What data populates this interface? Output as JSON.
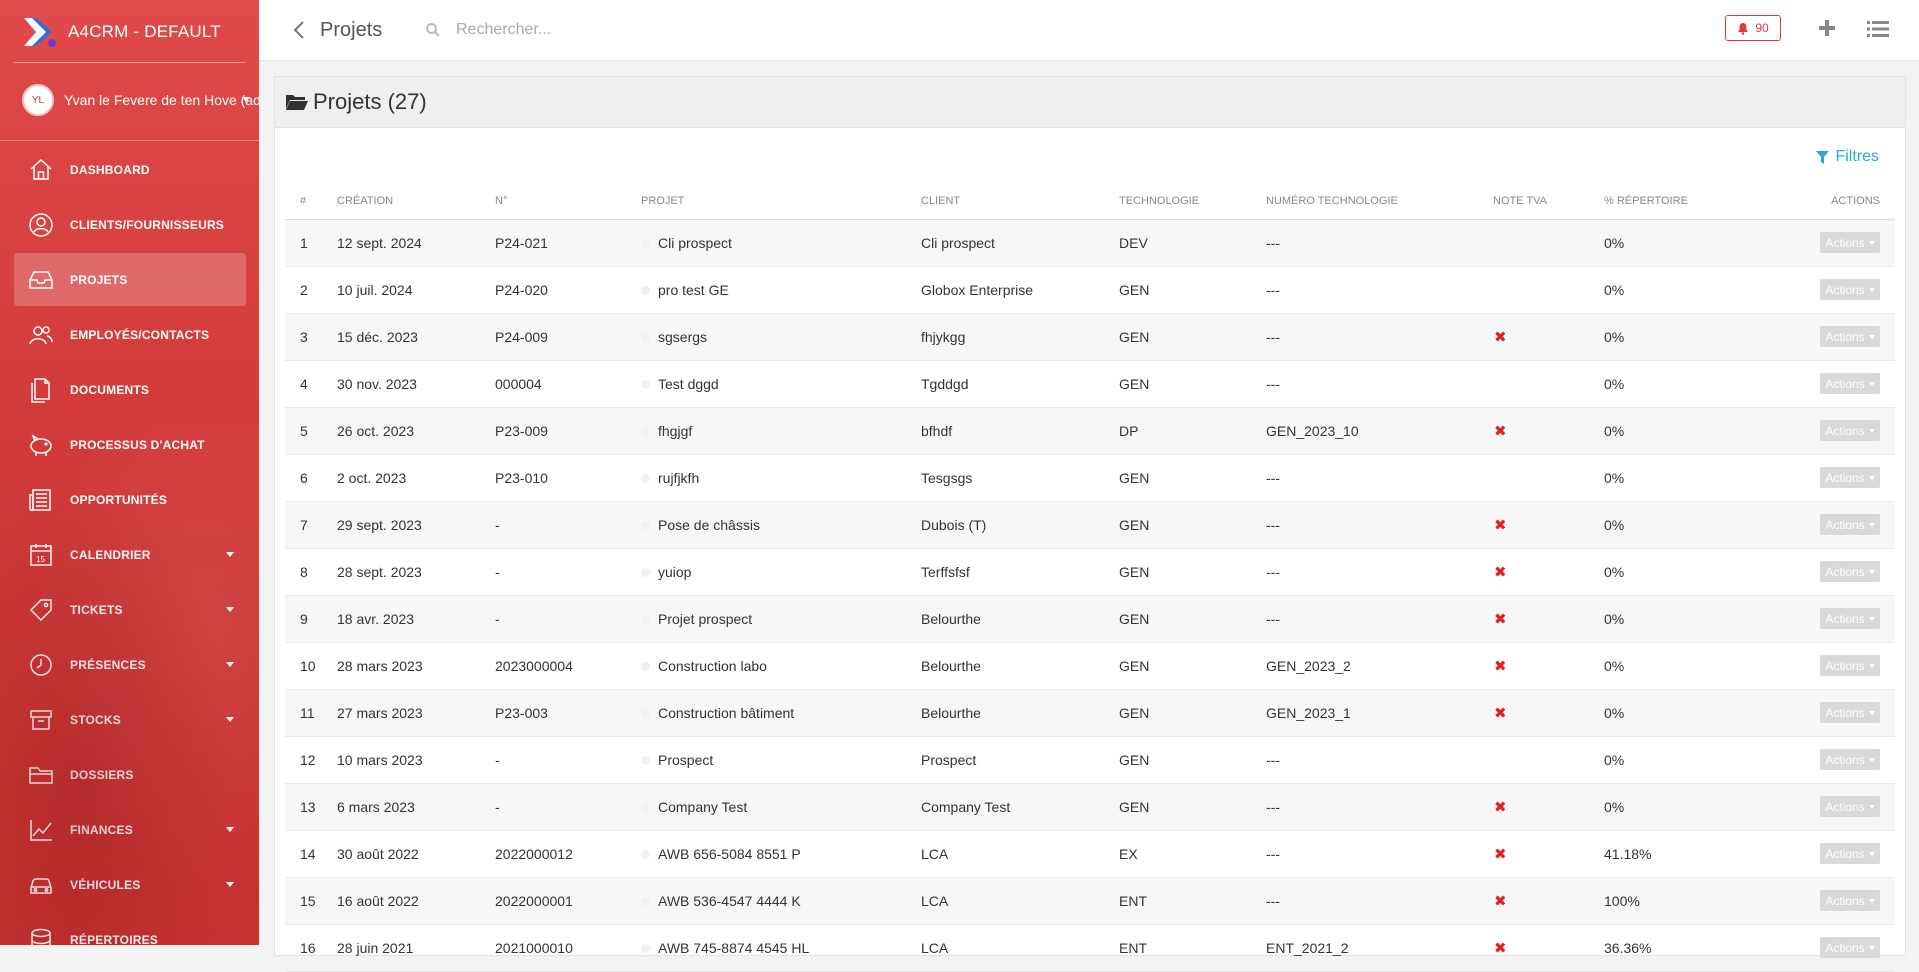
{
  "app": {
    "title": "A4CRM - DEFAULT"
  },
  "user": {
    "initials": "YL",
    "name": "Yvan le Fevere de ten Hove (ad"
  },
  "sidebar": {
    "items": [
      {
        "label": "DASHBOARD",
        "icon": "home-icon",
        "active": false,
        "has_caret": false
      },
      {
        "label": "CLIENTS/FOURNISSEURS",
        "icon": "user-circle-icon",
        "active": false,
        "has_caret": false
      },
      {
        "label": "PROJETS",
        "icon": "inbox-icon",
        "active": true,
        "has_caret": false
      },
      {
        "label": "EMPLOYÉS/CONTACTS",
        "icon": "users-icon",
        "active": false,
        "has_caret": false
      },
      {
        "label": "DOCUMENTS",
        "icon": "documents-icon",
        "active": false,
        "has_caret": false
      },
      {
        "label": "PROCESSUS D'ACHAT",
        "icon": "piggy-bank-icon",
        "active": false,
        "has_caret": false
      },
      {
        "label": "OPPORTUNITÉS",
        "icon": "newspaper-icon",
        "active": false,
        "has_caret": false
      },
      {
        "label": "CALENDRIER",
        "icon": "calendar-icon",
        "active": false,
        "has_caret": true
      },
      {
        "label": "TICKETS",
        "icon": "tag-icon",
        "active": false,
        "has_caret": true
      },
      {
        "label": "PRÉSENCES",
        "icon": "clock-icon",
        "active": false,
        "has_caret": true
      },
      {
        "label": "STOCKS",
        "icon": "archive-icon",
        "active": false,
        "has_caret": true
      },
      {
        "label": "DOSSIERS",
        "icon": "folder-icon",
        "active": false,
        "has_caret": false
      },
      {
        "label": "FINANCES",
        "icon": "chart-line-icon",
        "active": false,
        "has_caret": true
      },
      {
        "label": "VÉHICULES",
        "icon": "car-icon",
        "active": false,
        "has_caret": true
      },
      {
        "label": "RÉPERTOIRES",
        "icon": "database-icon",
        "active": false,
        "has_caret": false
      }
    ]
  },
  "topbar": {
    "breadcrumb": "Projets",
    "search_placeholder": "Rechercher...",
    "notification_count": "90"
  },
  "panel": {
    "title": "Projets (27)",
    "filters_label": "Filtres"
  },
  "table": {
    "columns": [
      "#",
      "CRÉATION",
      "N°",
      "PROJET",
      "CLIENT",
      "TECHNOLOGIE",
      "NUMÉRO TECHNOLOGIE",
      "NOTE TVA",
      "% RÉPERTOIRE",
      "ACTIONS"
    ],
    "action_label": "Actions",
    "rows": [
      {
        "idx": "1",
        "created": "12 sept. 2024",
        "num": "P24-021",
        "project": "Cli prospect",
        "client": "Cli prospect",
        "tech": "DEV",
        "tech_num": "---",
        "vat": "",
        "pct": "0%"
      },
      {
        "idx": "2",
        "created": "10 juil. 2024",
        "num": "P24-020",
        "project": "pro test GE",
        "client": "Globox Enterprise",
        "tech": "GEN",
        "tech_num": "---",
        "vat": "",
        "pct": "0%"
      },
      {
        "idx": "3",
        "created": "15 déc. 2023",
        "num": "P24-009",
        "project": "sgsergs",
        "client": "fhjykgg",
        "tech": "GEN",
        "tech_num": "---",
        "vat": "✖",
        "pct": "0%"
      },
      {
        "idx": "4",
        "created": "30 nov. 2023",
        "num": "000004",
        "project": "Test dggd",
        "client": "Tgddgd",
        "tech": "GEN",
        "tech_num": "---",
        "vat": "",
        "pct": "0%"
      },
      {
        "idx": "5",
        "created": "26 oct. 2023",
        "num": "P23-009",
        "project": "fhgjgf",
        "client": "bfhdf",
        "tech": "DP",
        "tech_num": "GEN_2023_10",
        "vat": "✖",
        "pct": "0%"
      },
      {
        "idx": "6",
        "created": "2 oct. 2023",
        "num": "P23-010",
        "project": "rujfjkfh",
        "client": "Tesgsgs",
        "tech": "GEN",
        "tech_num": "---",
        "vat": "",
        "pct": "0%"
      },
      {
        "idx": "7",
        "created": "29 sept. 2023",
        "num": "-",
        "project": "Pose de châssis",
        "client": "Dubois (T)",
        "tech": "GEN",
        "tech_num": "---",
        "vat": "✖",
        "pct": "0%"
      },
      {
        "idx": "8",
        "created": "28 sept. 2023",
        "num": "-",
        "project": "yuiop",
        "client": "Terffsfsf",
        "tech": "GEN",
        "tech_num": "---",
        "vat": "✖",
        "pct": "0%"
      },
      {
        "idx": "9",
        "created": "18 avr. 2023",
        "num": "-",
        "project": "Projet prospect",
        "client": "Belourthe",
        "tech": "GEN",
        "tech_num": "---",
        "vat": "✖",
        "pct": "0%"
      },
      {
        "idx": "10",
        "created": "28 mars 2023",
        "num": "2023000004",
        "project": "Construction labo",
        "client": "Belourthe",
        "tech": "GEN",
        "tech_num": "GEN_2023_2",
        "vat": "✖",
        "pct": "0%"
      },
      {
        "idx": "11",
        "created": "27 mars 2023",
        "num": "P23-003",
        "project": "Construction bâtiment",
        "client": "Belourthe",
        "tech": "GEN",
        "tech_num": "GEN_2023_1",
        "vat": "✖",
        "pct": "0%"
      },
      {
        "idx": "12",
        "created": "10 mars 2023",
        "num": "-",
        "project": "Prospect",
        "client": "Prospect",
        "tech": "GEN",
        "tech_num": "---",
        "vat": "",
        "pct": "0%"
      },
      {
        "idx": "13",
        "created": "6 mars 2023",
        "num": "-",
        "project": "Company Test",
        "client": "Company Test",
        "tech": "GEN",
        "tech_num": "---",
        "vat": "✖",
        "pct": "0%"
      },
      {
        "idx": "14",
        "created": "30 août 2022",
        "num": "2022000012",
        "project": "AWB 656-5084 8551 P",
        "client": "LCA",
        "tech": "EX",
        "tech_num": "---",
        "vat": "✖",
        "pct": "41.18%"
      },
      {
        "idx": "15",
        "created": "16 août 2022",
        "num": "2022000001",
        "project": "AWB 536-4547 4444 K",
        "client": "LCA",
        "tech": "ENT",
        "tech_num": "---",
        "vat": "✖",
        "pct": "100%"
      },
      {
        "idx": "16",
        "created": "28 juin 2021",
        "num": "2021000010",
        "project": "AWB 745-8874 4545 HL",
        "client": "LCA",
        "tech": "ENT",
        "tech_num": "ENT_2021_2",
        "vat": "✖",
        "pct": "36.36%"
      }
    ]
  }
}
